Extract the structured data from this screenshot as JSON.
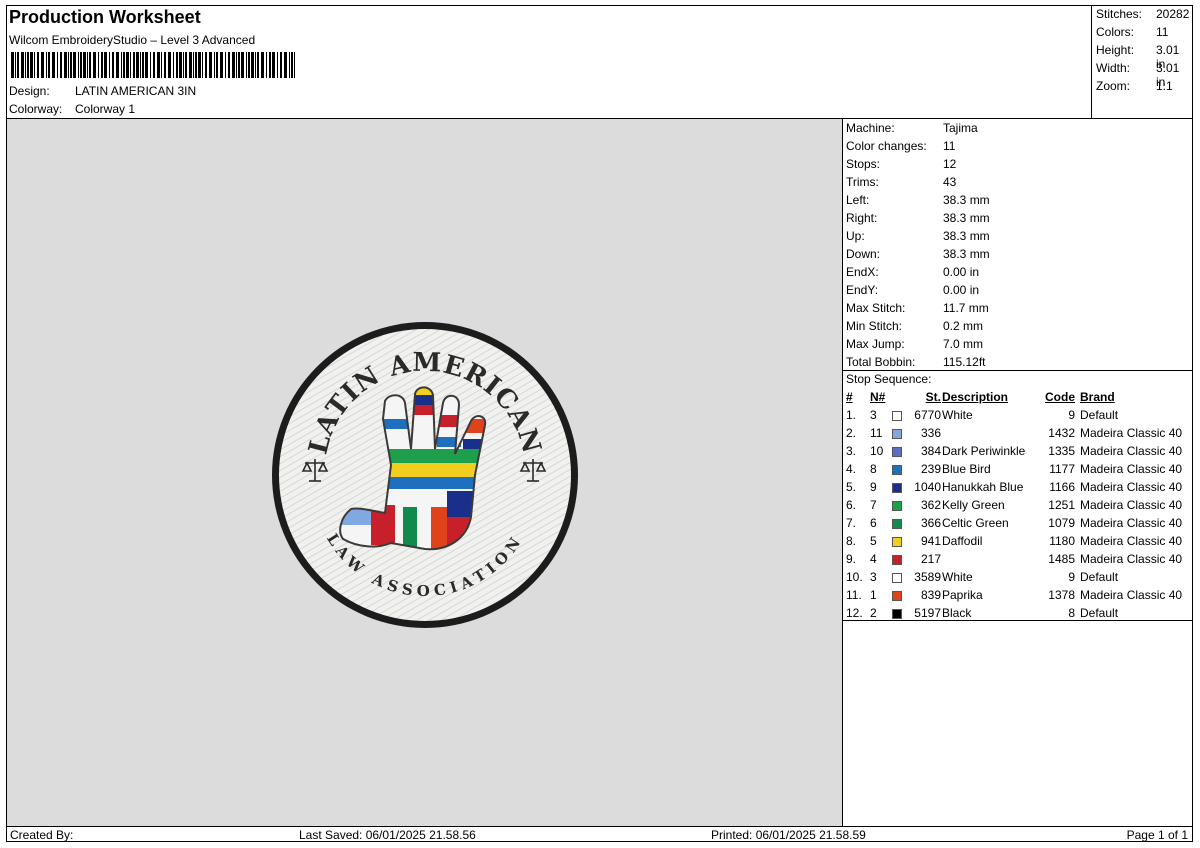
{
  "header": {
    "title": "Production Worksheet",
    "software": "Wilcom EmbroideryStudio – Level 3 Advanced",
    "design_label": "Design:",
    "design_value": "LATIN AMERICAN 3IN",
    "colorway_label": "Colorway:",
    "colorway_value": "Colorway 1"
  },
  "stats": [
    {
      "label": "Stitches:",
      "value": "20282"
    },
    {
      "label": "Colors:",
      "value": "11"
    },
    {
      "label": "Height:",
      "value": "3.01 in"
    },
    {
      "label": "Width:",
      "value": "3.01 in"
    },
    {
      "label": "Zoom:",
      "value": "1:1"
    }
  ],
  "machine": [
    {
      "label": "Machine:",
      "value": "Tajima"
    },
    {
      "label": "Color changes:",
      "value": "11"
    },
    {
      "label": "Stops:",
      "value": "12"
    },
    {
      "label": "Trims:",
      "value": "43"
    },
    {
      "label": "Left:",
      "value": "38.3 mm"
    },
    {
      "label": "Right:",
      "value": "38.3 mm"
    },
    {
      "label": "Up:",
      "value": "38.3 mm"
    },
    {
      "label": "Down:",
      "value": "38.3 mm"
    },
    {
      "label": "EndX:",
      "value": "0.00 in"
    },
    {
      "label": "EndY:",
      "value": "0.00 in"
    },
    {
      "label": "Max Stitch:",
      "value": "11.7 mm"
    },
    {
      "label": "Min Stitch:",
      "value": "0.2 mm"
    },
    {
      "label": "Max Jump:",
      "value": "7.0 mm"
    },
    {
      "label": "Total Bobbin:",
      "value": "115.12ft"
    }
  ],
  "stop_sequence": {
    "label": "Stop Sequence:",
    "headers": {
      "idx": "#",
      "n": "N#",
      "st": "St.",
      "desc": "Description",
      "code": "Code",
      "brand": "Brand"
    },
    "rows": [
      {
        "idx": "1.",
        "n": "3",
        "color": "#ffffff",
        "st": "6770",
        "desc": "White",
        "code": "9",
        "brand": "Default"
      },
      {
        "idx": "2.",
        "n": "11",
        "color": "#7fa9e0",
        "st": "336",
        "desc": "",
        "code": "1432",
        "brand": "Madeira Classic 40"
      },
      {
        "idx": "3.",
        "n": "10",
        "color": "#5a6fc4",
        "st": "384",
        "desc": "Dark Periwinkle",
        "code": "1335",
        "brand": "Madeira Classic 40"
      },
      {
        "idx": "4.",
        "n": "8",
        "color": "#1f6fbf",
        "st": "239",
        "desc": "Blue Bird",
        "code": "1177",
        "brand": "Madeira Classic 40"
      },
      {
        "idx": "5.",
        "n": "9",
        "color": "#1a2f8a",
        "st": "1040",
        "desc": "Hanukkah Blue",
        "code": "1166",
        "brand": "Madeira Classic 40"
      },
      {
        "idx": "6.",
        "n": "7",
        "color": "#1ea04a",
        "st": "362",
        "desc": "Kelly Green",
        "code": "1251",
        "brand": "Madeira Classic 40"
      },
      {
        "idx": "7.",
        "n": "6",
        "color": "#118a4e",
        "st": "366",
        "desc": "Celtic Green",
        "code": "1079",
        "brand": "Madeira Classic 40"
      },
      {
        "idx": "8.",
        "n": "5",
        "color": "#f2cf1e",
        "st": "941",
        "desc": "Daffodil",
        "code": "1180",
        "brand": "Madeira Classic 40"
      },
      {
        "idx": "9.",
        "n": "4",
        "color": "#c8202a",
        "st": "217",
        "desc": "",
        "code": "1485",
        "brand": "Madeira Classic 40"
      },
      {
        "idx": "10.",
        "n": "3",
        "color": "#ffffff",
        "st": "3589",
        "desc": "White",
        "code": "9",
        "brand": "Default"
      },
      {
        "idx": "11.",
        "n": "1",
        "color": "#e0431c",
        "st": "839",
        "desc": "Paprika",
        "code": "1378",
        "brand": "Madeira Classic 40"
      },
      {
        "idx": "12.",
        "n": "2",
        "color": "#000000",
        "st": "5197",
        "desc": "Black",
        "code": "8",
        "brand": "Default"
      }
    ]
  },
  "patch": {
    "top_text": "LATIN AMERICAN",
    "bottom_text": "LAW ASSOCIATION"
  },
  "footer": {
    "created_by": "Created By:",
    "last_saved": "Last Saved: 06/01/2025 21.58.56",
    "printed": "Printed: 06/01/2025 21.58.59",
    "page": "Page 1 of 1"
  }
}
